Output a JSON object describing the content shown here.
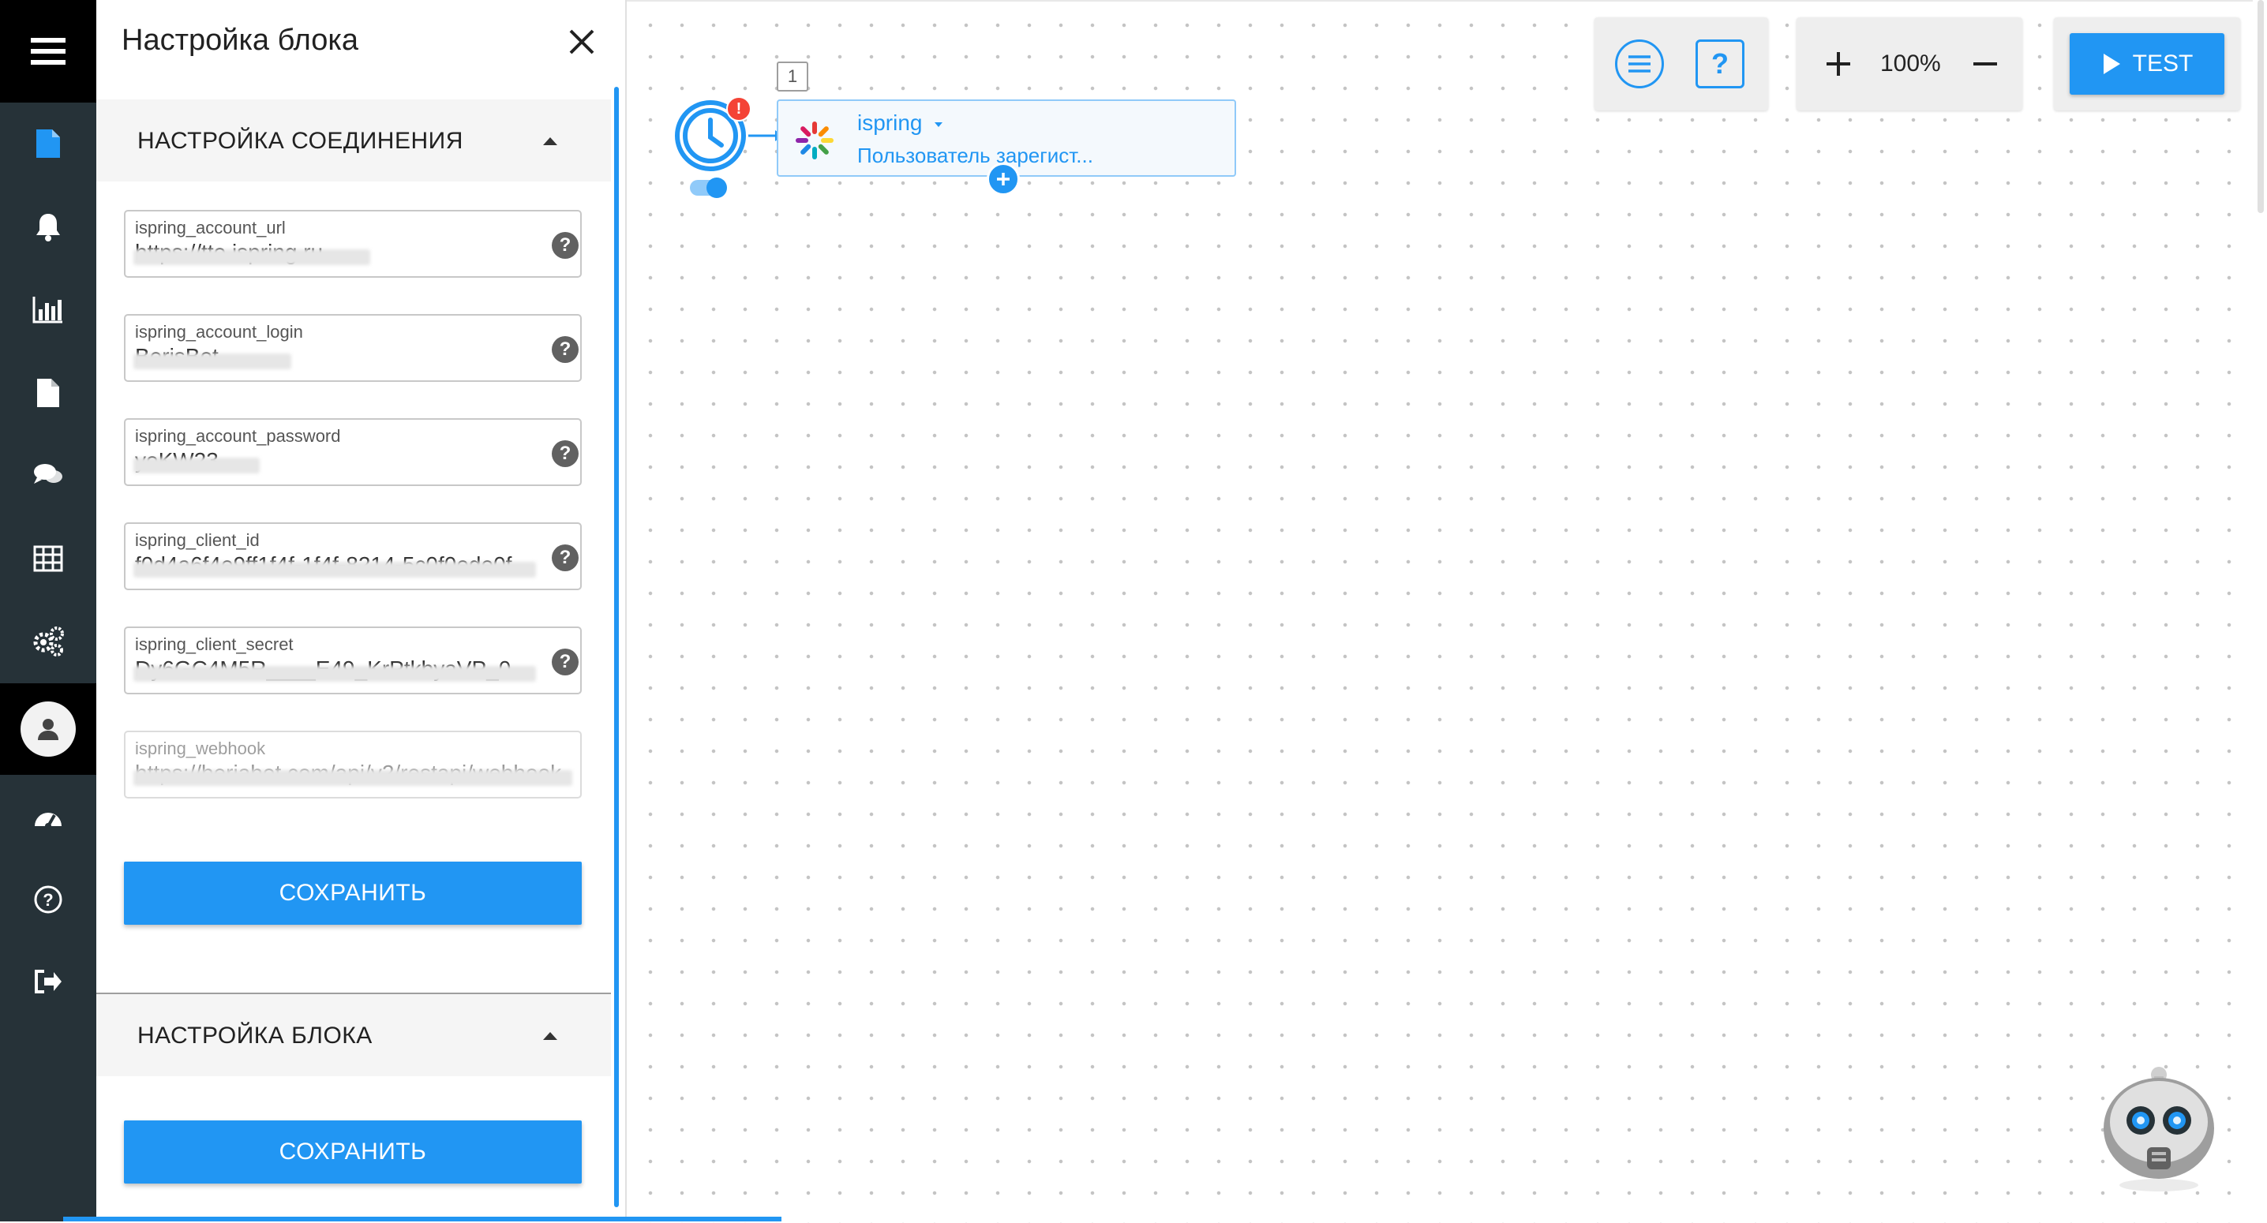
{
  "sidebar": {
    "items": [
      {
        "name": "document-icon"
      },
      {
        "name": "bell-icon"
      },
      {
        "name": "chart-icon"
      },
      {
        "name": "file-icon"
      },
      {
        "name": "chat-icon"
      },
      {
        "name": "table-icon"
      },
      {
        "name": "gears-icon"
      },
      {
        "name": "user-avatar"
      },
      {
        "name": "dashboard-icon"
      },
      {
        "name": "help-icon"
      },
      {
        "name": "logout-icon"
      }
    ]
  },
  "panel": {
    "title": "Настройка блока",
    "connection_section": {
      "label": "НАСТРОЙКА СОЕДИНЕНИЯ",
      "fields": [
        {
          "label": "ispring_account_url",
          "value": "https://tto.ispring.ru"
        },
        {
          "label": "ispring_account_login",
          "value": "BerisBot"
        },
        {
          "label": "ispring_account_password",
          "value": "yoKW23"
        },
        {
          "label": "ispring_client_id",
          "value": "f0d4a6f4e9ff1f4f-1f4f-8214-5c0f0ede0f"
        },
        {
          "label": "ispring_client_secret",
          "value": "Dy6GC4M5R____E49_KrPtkbyaVP_0"
        },
        {
          "label": "ispring_webhook",
          "value": "https://beriabot.com/api/v2/restapi/webhook"
        }
      ],
      "save_label": "СОХРАНИТЬ"
    },
    "block_section": {
      "label": "НАСТРОЙКА БЛОКА",
      "save_label": "СОХРАНИТЬ"
    }
  },
  "toolbar": {
    "zoom": "100%",
    "help_label": "?",
    "test_label": "TEST"
  },
  "flow": {
    "step_number": "1",
    "block_title": "ispring",
    "block_subtitle": "Пользователь зарегист..."
  },
  "colors": {
    "accent": "#2196f3",
    "sidebar": "#263238",
    "sidebar_active": "#000000",
    "alert": "#f44336"
  }
}
